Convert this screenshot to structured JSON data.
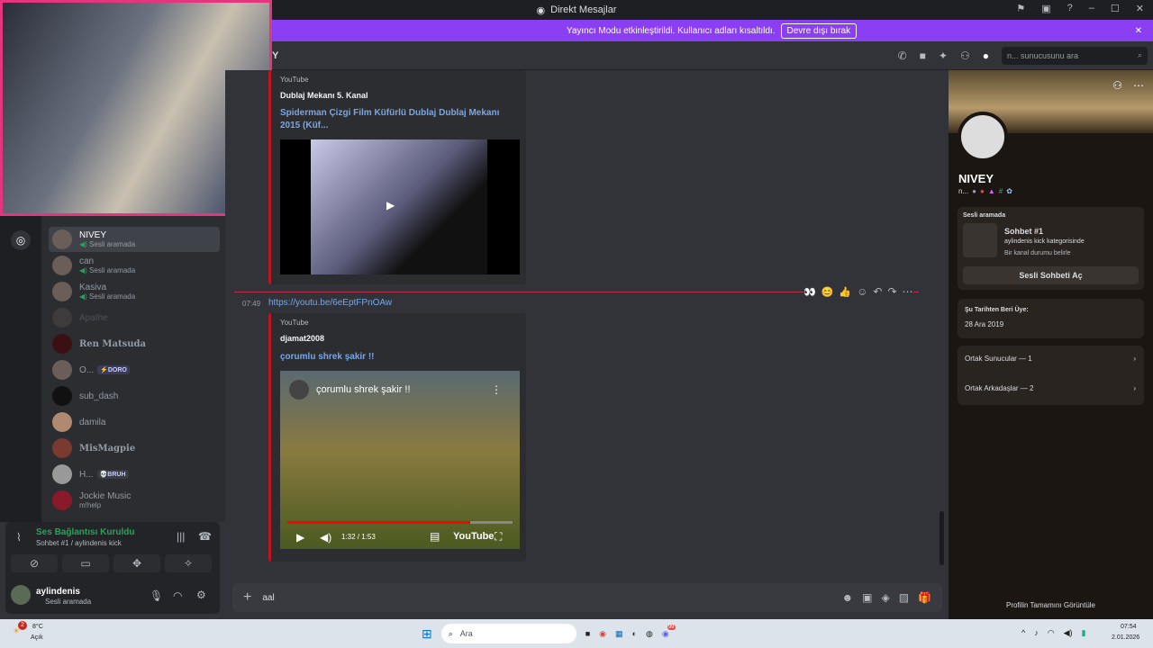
{
  "window": {
    "title": "Direkt Mesajlar"
  },
  "banner": {
    "text": "Yayıncı Modu etkinleştirildi. Kullanıcı adları kısaltıldı.",
    "button": "Devre dışı bırak",
    "color": "#8b3ff3"
  },
  "header": {
    "channel_letter": "Y",
    "search_placeholder": "n... sunucusunu ara"
  },
  "dm_list": [
    {
      "name": "NIVEY",
      "status": "Sesli aramada",
      "voice": true
    },
    {
      "name": "can",
      "status": "Sesli aramada",
      "voice": true
    },
    {
      "name": "Kasiva",
      "status": "Sesli aramada",
      "voice": true
    },
    {
      "name": "Apathe",
      "status": ""
    },
    {
      "name": "Ren Matsuda",
      "status": ""
    },
    {
      "name": "O...",
      "status": "",
      "tag": "⚡DORO"
    },
    {
      "name": "sub_dash",
      "status": ""
    },
    {
      "name": "damila",
      "status": ""
    },
    {
      "name": "MisMagpie",
      "status": ""
    },
    {
      "name": "H...",
      "status": "",
      "tag": "💀BRUH"
    },
    {
      "name": "Jockie Music",
      "status": "m!help"
    }
  ],
  "voice_panel": {
    "title": "Ses Bağlantısı Kuruldu",
    "subtitle": "Sohbet #1 / aylindenis kick"
  },
  "user": {
    "name": "aylindenis",
    "status": "Sesli aramada"
  },
  "messages": [
    {
      "embed": {
        "provider": "YouTube",
        "author": "Dublaj Mekanı 5. Kanal",
        "title": "Spiderman Çizgi Film Küfürlü Dublaj   Dublaj Mekanı 2015 (Küf..."
      }
    },
    {
      "time": "07:49",
      "link": "https://youtu.be/6eEptFPnOAw",
      "embed": {
        "provider": "YouTube",
        "author": "djamat2008",
        "title": "çorumlu shrek şakir !!",
        "video_title": "çorumlu shrek şakir !!",
        "time": "1:32 / 1:53",
        "logo": "YouTube",
        "progress": 0.81
      }
    }
  ],
  "composer": {
    "value": "aal"
  },
  "profile": {
    "name": "NIVEY",
    "short": "n...",
    "voice_label": "Sesli aramada",
    "channel": "Sohbet #1",
    "category": "aylindenis kick kategorisinde",
    "status_prompt": "Bir kanal durumu belirle",
    "join_button": "Sesli Sohbeti Aç",
    "member_since_label": "Şu Tarihten Beri Üye:",
    "member_since": "28 Ara 2019",
    "mutual_servers": "Ortak Sunucular — 1",
    "mutual_friends": "Ortak Arkadaşlar — 2",
    "view_full": "Profilin Tamamını Görüntüle"
  },
  "taskbar": {
    "weather_temp": "8°C",
    "weather_desc": "Açık",
    "weather_badge": "2",
    "search": "Ara",
    "time": "07:54",
    "date": "2.01.2026",
    "discord_badge": "99"
  }
}
